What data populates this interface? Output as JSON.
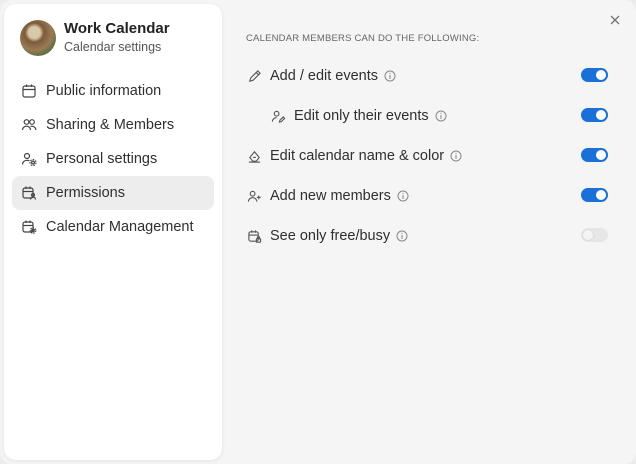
{
  "calendar": {
    "title": "Work Calendar",
    "subtitle": "Calendar settings"
  },
  "sidebar": {
    "items": [
      {
        "label": "Public information",
        "icon": "calendar-icon",
        "active": false
      },
      {
        "label": "Sharing & Members",
        "icon": "users-icon",
        "active": false
      },
      {
        "label": "Personal settings",
        "icon": "user-gear-icon",
        "active": false
      },
      {
        "label": "Permissions",
        "icon": "calendar-user-icon",
        "active": true
      },
      {
        "label": "Calendar Management",
        "icon": "calendar-gear-icon",
        "active": false
      }
    ]
  },
  "permissions": {
    "heading": "CALENDAR MEMBERS CAN DO THE FOLLOWING:",
    "rows": [
      {
        "label": "Add / edit events",
        "icon": "pencil-icon",
        "enabled": true
      },
      {
        "label": "Edit only their events",
        "icon": "user-edit-icon",
        "enabled": true
      },
      {
        "label": "Edit calendar name & color",
        "icon": "paint-bucket-icon",
        "enabled": true
      },
      {
        "label": "Add new members",
        "icon": "user-plus-icon",
        "enabled": true
      },
      {
        "label": "See only free/busy",
        "icon": "calendar-lock-icon",
        "enabled": false
      }
    ]
  },
  "colors": {
    "accent": "#1a6fd8",
    "toggle_off": "#e6e6e6"
  }
}
